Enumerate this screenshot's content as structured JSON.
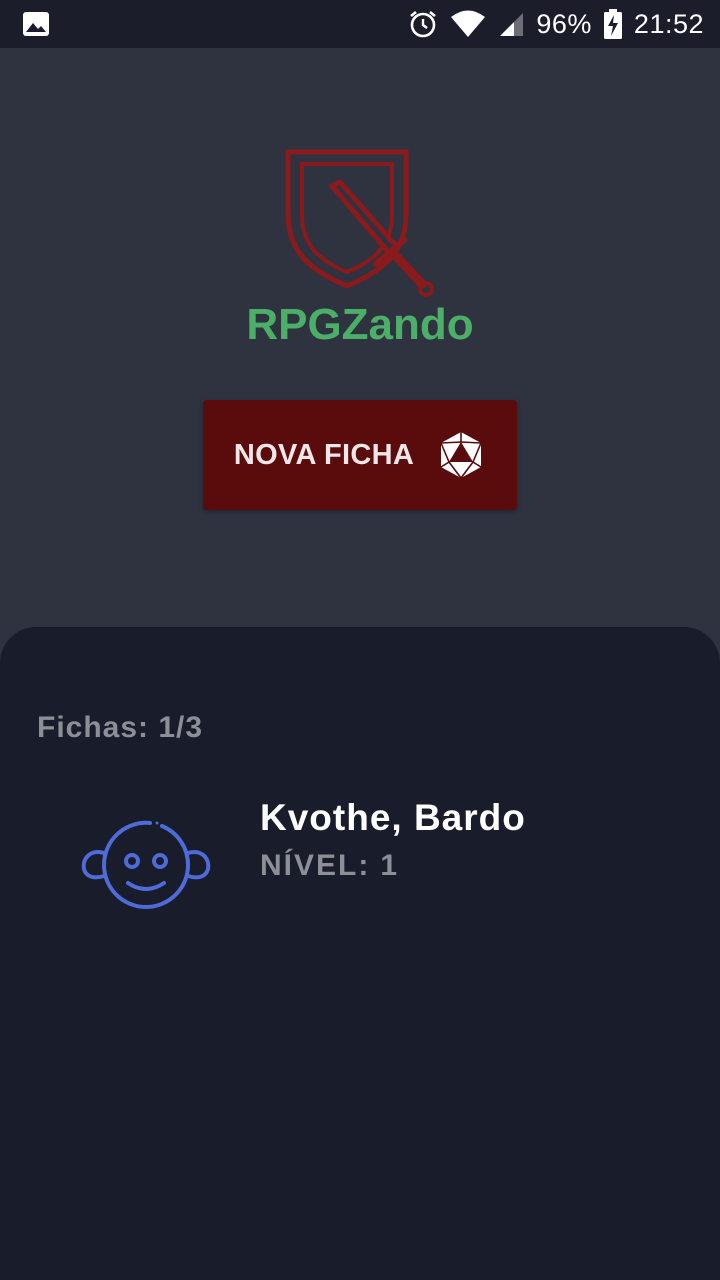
{
  "status_bar": {
    "battery": "96%",
    "time": "21:52",
    "icons": [
      "image-icon",
      "alarm-icon",
      "wifi-icon",
      "signal-icon",
      "battery-charging-icon"
    ]
  },
  "app": {
    "name": "RPGZando",
    "logo_icon": "shield-sword-icon",
    "logo_color": "#8b1a1c",
    "name_color": "#4caf67"
  },
  "new_sheet_button": {
    "label": "NOVA FICHA",
    "icon": "d20-dice-icon",
    "background": "#5a0b0c"
  },
  "sheets": {
    "label": "Fichas:",
    "count": "1/3",
    "items": [
      {
        "name": "Kvothe, Bardo",
        "level_label": "NÍVEL:",
        "level": "1",
        "avatar_icon": "baby-face-icon",
        "avatar_color": "#4f6bd8"
      }
    ]
  }
}
